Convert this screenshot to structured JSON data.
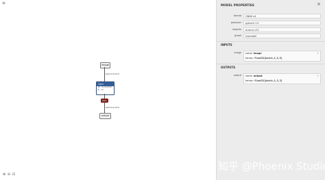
{
  "graph": {
    "menu_icon": "≡",
    "nodes": {
      "input": {
        "label": "image"
      },
      "conv": {
        "label": "Conv",
        "attrs": [
          "W 〈1×1×5×5〉",
          "B 〈1〉"
        ]
      },
      "relu": {
        "label": "Relu"
      },
      "output": {
        "label": "output"
      }
    },
    "edges": {
      "input_to_conv": "batch×1×3×3",
      "relu_to_output": "batch×1×3×3"
    },
    "toolbar": {
      "zoom_in": "⊕",
      "zoom_out": "⊖",
      "fit": "⊡"
    }
  },
  "panel": {
    "title": "MODEL PROPERTIES",
    "close_icon": "×",
    "properties": [
      {
        "label": "format",
        "value": "ONNX v4"
      },
      {
        "label": "producer",
        "value": "pytorch 1.9"
      },
      {
        "label": "imports",
        "value": "ai.onnx v11"
      },
      {
        "label": "graph",
        "value": "mymodel"
      }
    ],
    "inputs_title": "INPUTS",
    "input": {
      "label": "image",
      "name_key": "name:",
      "name": "image",
      "tensor_key": "tensor:",
      "tensor": "float32[batch,1,5,5]"
    },
    "outputs_title": "OUTPUTS",
    "output": {
      "label": "output",
      "name_key": "name:",
      "name": "output",
      "tensor_key": "tensor:",
      "tensor": "float32[batch,1,3,3]"
    }
  },
  "watermark": "知乎 @Phoenix Studio"
}
